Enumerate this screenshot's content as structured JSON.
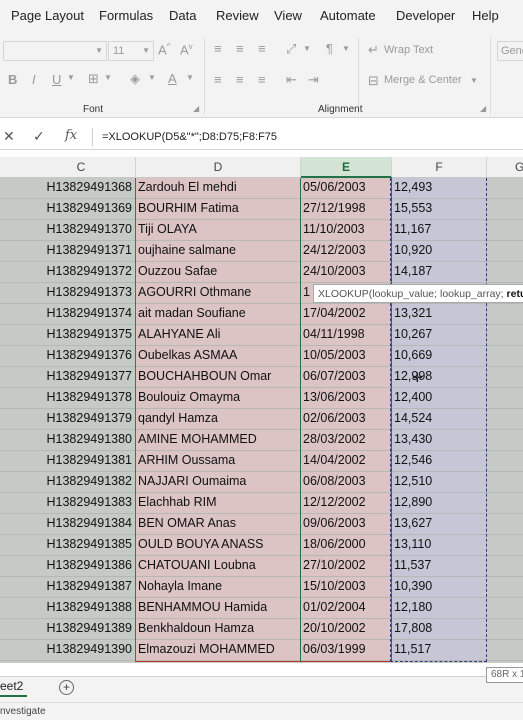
{
  "menu": {
    "tabs": [
      "Page Layout",
      "Formulas",
      "Data",
      "Review",
      "View",
      "Automate",
      "Developer",
      "Help"
    ]
  },
  "ribbon": {
    "font_size": "11",
    "font_group_label": "Font",
    "alignment_group_label": "Alignment",
    "wrap_text_label": "Wrap Text",
    "merge_center_label": "Merge & Center",
    "number_format_partial": "Gene"
  },
  "formula_bar": {
    "formula": "=XLOOKUP(D5&\"*\";D8:D75;F8:F75"
  },
  "columns": [
    "C",
    "D",
    "E",
    "F",
    "G"
  ],
  "selected_column": "E",
  "tooltip": {
    "text": "XLOOKUP(lookup_value; lookup_array; ",
    "bold_text": "retu"
  },
  "rows": [
    {
      "id": "H13829491368",
      "name": "Zardouh  El mehdi",
      "date": "05/06/2003",
      "value": "12,493"
    },
    {
      "id": "H13829491369",
      "name": "BOURHIM Fatima",
      "date": "27/12/1998",
      "value": "15,553"
    },
    {
      "id": "H13829491370",
      "name": "Tiji OLAYA",
      "date": "11/10/2003",
      "value": "11,167"
    },
    {
      "id": "H13829491371",
      "name": "oujhaine salmane",
      "date": "24/12/2003",
      "value": "10,920"
    },
    {
      "id": "H13829491372",
      "name": "Ouzzou  Safae",
      "date": "24/10/2003",
      "value": "14,187"
    },
    {
      "id": "H13829491373",
      "name": "AGOURRI Othmane",
      "date": "1",
      "value": ""
    },
    {
      "id": "H13829491374",
      "name": "ait madan Soufiane",
      "date": "17/04/2002",
      "value": "13,321"
    },
    {
      "id": "H13829491375",
      "name": "ALAHYANE Ali",
      "date": "04/11/1998",
      "value": "10,267"
    },
    {
      "id": "H13829491376",
      "name": "Oubelkas ASMAA",
      "date": "10/05/2003",
      "value": "10,669"
    },
    {
      "id": "H13829491377",
      "name": "BOUCHAHBOUN Omar",
      "date": "06/07/2003",
      "value": "12,998"
    },
    {
      "id": "H13829491378",
      "name": "Boulouiz Omayma",
      "date": "13/06/2003",
      "value": "12,400"
    },
    {
      "id": "H13829491379",
      "name": "qandyl Hamza",
      "date": "02/06/2003",
      "value": "14,524"
    },
    {
      "id": "H13829491380",
      "name": "AMINE MOHAMMED",
      "date": "28/03/2002",
      "value": "13,430"
    },
    {
      "id": "H13829491381",
      "name": "ARHIM Oussama",
      "date": "14/04/2002",
      "value": "12,546"
    },
    {
      "id": "H13829491382",
      "name": "NAJJARI Oumaima",
      "date": "06/08/2003",
      "value": "12,510"
    },
    {
      "id": "H13829491383",
      "name": "Elachhab RIM",
      "date": "12/12/2002",
      "value": "12,890"
    },
    {
      "id": "H13829491384",
      "name": "BEN OMAR Anas",
      "date": "09/06/2003",
      "value": "13,627"
    },
    {
      "id": "H13829491385",
      "name": "OULD BOUYA ANASS",
      "date": "18/06/2000",
      "value": "13,110"
    },
    {
      "id": "H13829491386",
      "name": "CHATOUANI Loubna",
      "date": "27/10/2002",
      "value": "11,537"
    },
    {
      "id": "H13829491387",
      "name": "Nohayla Imane",
      "date": "15/10/2003",
      "value": "10,390"
    },
    {
      "id": "H13829491388",
      "name": "BENHAMMOU Hamida",
      "date": "01/02/2004",
      "value": "12,180"
    },
    {
      "id": "H13829491389",
      "name": "Benkhaldoun Hamza",
      "date": "20/10/2002",
      "value": "17,808"
    },
    {
      "id": "H13829491390",
      "name": "Elmazouzi  MOHAMMED",
      "date": "06/03/1999",
      "value": "11,517"
    }
  ],
  "sheet_tab": "eet2",
  "selection_count": "68R x 1",
  "status": "nvestigate",
  "colors": {
    "excel_green": "#217346",
    "highlight_pink": "#dcc3c4",
    "highlight_lavender": "#c6c6d6",
    "grid_gray": "#c6cac6"
  }
}
